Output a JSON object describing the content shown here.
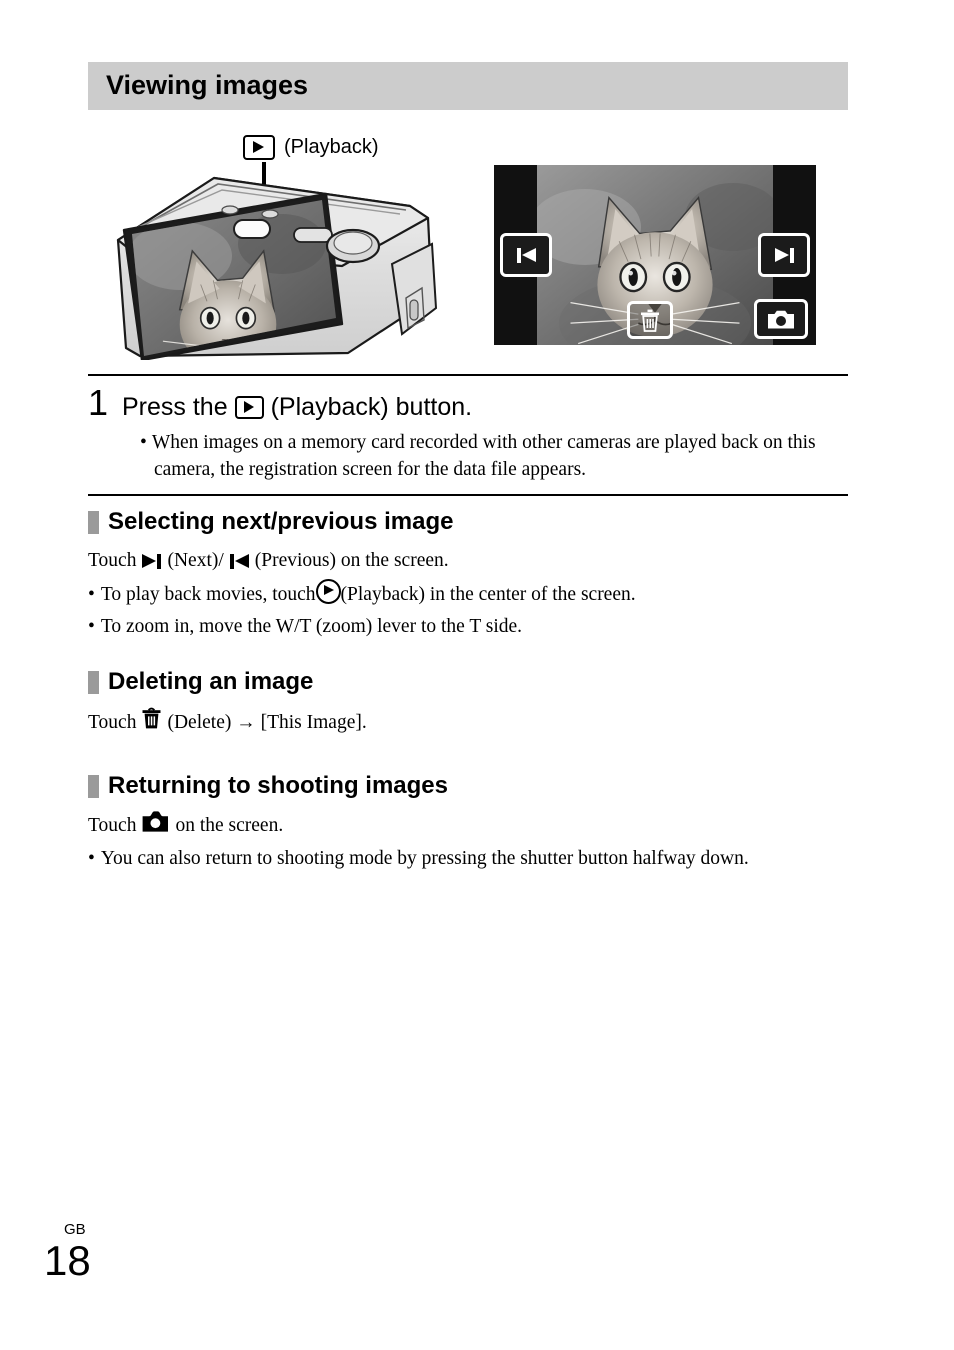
{
  "header": {
    "title": "Viewing images"
  },
  "figure": {
    "callout_label": "(Playback)",
    "callout_icon": "playback-button-icon",
    "camera_illustration_alt": "digital camera rear view with cat photo on LCD",
    "screen": {
      "alt": "playback screen showing cat photo",
      "buttons": [
        {
          "name": "previous-button",
          "icon": "previous-icon"
        },
        {
          "name": "next-button",
          "icon": "next-icon"
        },
        {
          "name": "delete-button",
          "icon": "trash-icon"
        },
        {
          "name": "shooting-button",
          "icon": "camera-icon"
        }
      ]
    }
  },
  "step": {
    "number": "1",
    "title_before": "Press the",
    "title_icon": "playback-button-icon",
    "title_after": "(Playback) button.",
    "bullets": [
      "When images on a memory card recorded with other cameras are played back on this camera, the registration screen for the data file appears."
    ]
  },
  "sections": [
    {
      "heading": "Selecting next/previous image",
      "lead": {
        "touch_word": "Touch",
        "next_icon": "next-icon",
        "next_label": "(Next)/",
        "prev_icon": "previous-icon",
        "prev_label": "(Previous) on the screen."
      },
      "bullets": [
        {
          "before": "To play back movies, touch",
          "icon": "playback-circle-icon",
          "after": "(Playback) in the center of the screen."
        },
        {
          "before": "To zoom in, move the W/T (zoom) lever to the T side.",
          "icon": null,
          "after": ""
        }
      ]
    },
    {
      "heading": "Deleting an image",
      "lead": {
        "touch_word": "Touch",
        "icon": "trash-icon",
        "after": "(Delete) → [This Image]."
      },
      "bullets": []
    },
    {
      "heading": "Returning to shooting images",
      "lead": {
        "touch_word": "Touch",
        "icon": "camera-icon",
        "after": "on the screen."
      },
      "bullets": [
        {
          "before": "You can also return to shooting mode by pressing the shutter button halfway down.",
          "icon": null,
          "after": ""
        }
      ]
    }
  ],
  "footer": {
    "region": "GB",
    "page_number": "18"
  },
  "colors": {
    "header_background": "#cccccc",
    "section_marker": "#9a9a9a",
    "text": "#000000",
    "page_background": "#ffffff"
  }
}
